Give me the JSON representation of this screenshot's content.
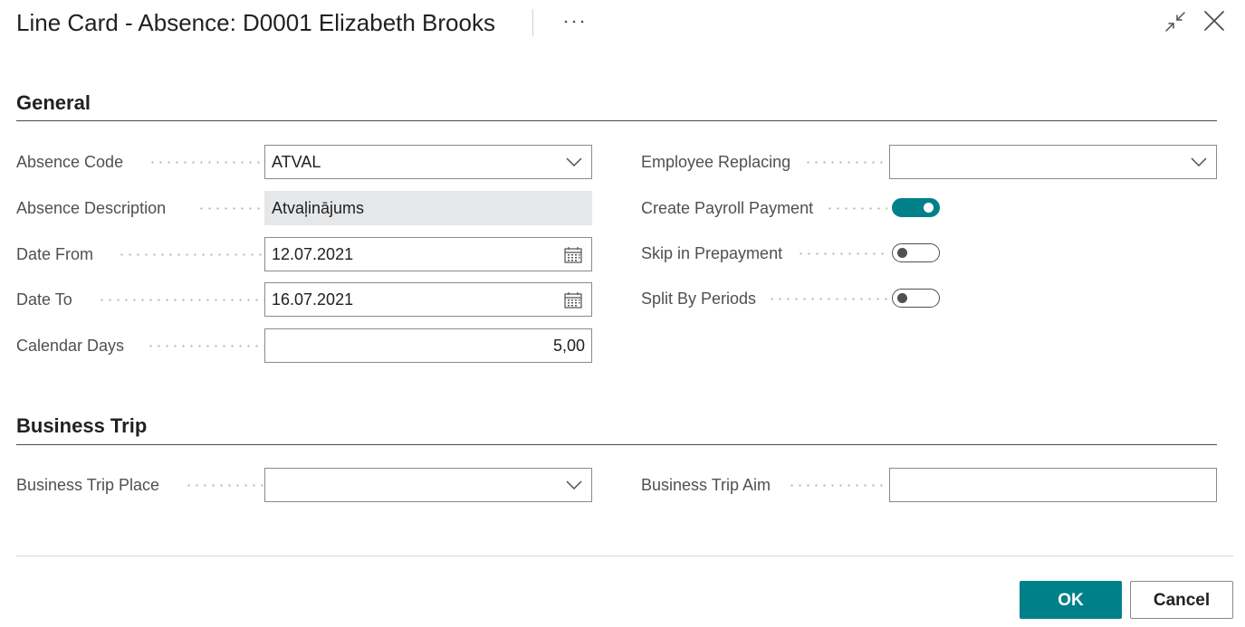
{
  "header": {
    "title": "Line Card - Absence: D0001 Elizabeth Brooks",
    "more_icon": "ellipsis-icon",
    "collapse_icon": "collapse-icon",
    "close_icon": "close-icon"
  },
  "sections": {
    "general": {
      "title": "General",
      "absence_code": {
        "label": "Absence Code",
        "value": "ATVAL"
      },
      "absence_description": {
        "label": "Absence Description",
        "value": "Atvaļinājums"
      },
      "date_from": {
        "label": "Date From",
        "value": "12.07.2021"
      },
      "date_to": {
        "label": "Date To",
        "value": "16.07.2021"
      },
      "calendar_days": {
        "label": "Calendar Days",
        "value": "5,00"
      },
      "employee_replacing": {
        "label": "Employee Replacing",
        "value": ""
      },
      "create_payroll_payment": {
        "label": "Create Payroll Payment",
        "checked": true
      },
      "skip_in_prepayment": {
        "label": "Skip in Prepayment",
        "checked": false
      },
      "split_by_periods": {
        "label": "Split By Periods",
        "checked": false
      }
    },
    "business_trip": {
      "title": "Business Trip",
      "place": {
        "label": "Business Trip Place",
        "value": ""
      },
      "aim": {
        "label": "Business Trip Aim",
        "value": ""
      }
    }
  },
  "footer": {
    "ok_label": "OK",
    "cancel_label": "Cancel"
  },
  "colors": {
    "accent": "#00818a",
    "text": "#212121",
    "label": "#505050",
    "readonly_bg": "#e6e7e8"
  }
}
